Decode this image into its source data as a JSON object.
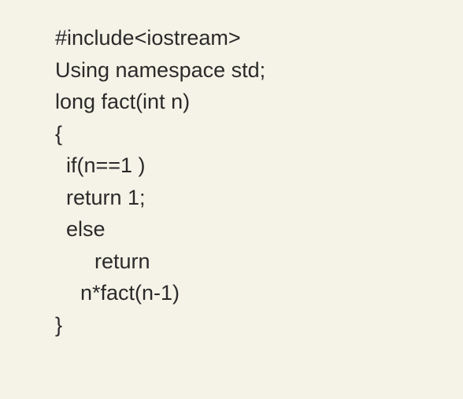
{
  "code": {
    "lines": [
      {
        "text": "#include<iostream>",
        "class": ""
      },
      {
        "text": "Using namespace std;",
        "class": ""
      },
      {
        "text": "long fact(int n)",
        "class": ""
      },
      {
        "text": "{",
        "class": ""
      },
      {
        "text": "if(n==1 )",
        "class": "indent1"
      },
      {
        "text": "return 1;",
        "class": "indent1"
      },
      {
        "text": "else",
        "class": "indent1"
      },
      {
        "text": "return",
        "class": "indent2"
      },
      {
        "text": "n*fact(n-1)",
        "class": "indent1b"
      },
      {
        "text": "}",
        "class": ""
      }
    ]
  }
}
